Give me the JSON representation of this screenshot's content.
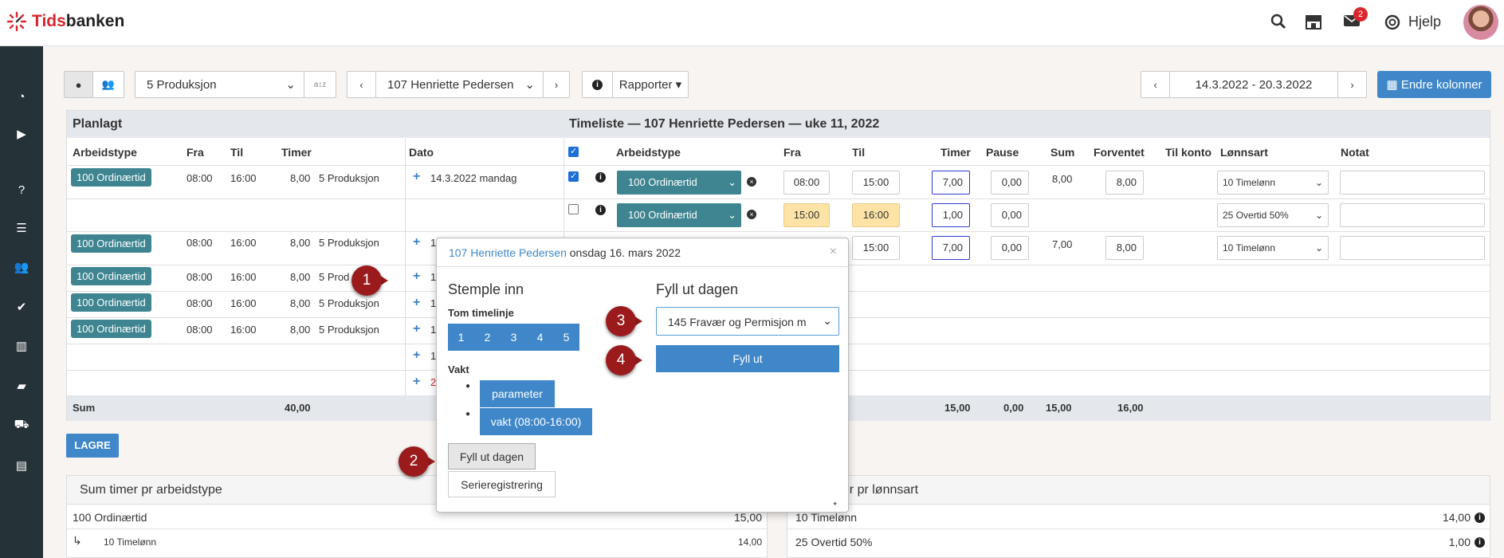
{
  "topbar": {
    "logo_part1": "Tids",
    "logo_part2": "banken",
    "mail_badge": "2",
    "help_label": "Hjelp"
  },
  "toolbar": {
    "department": "5 Produksjon",
    "employee": "107 Henriette Pedersen",
    "reports": "Rapporter",
    "date_range": "14.3.2022 - 20.3.2022",
    "change_columns": "Endre kolonner"
  },
  "planned": {
    "title": "Planlagt",
    "headers": {
      "type": "Arbeidstype",
      "from": "Fra",
      "to": "Til",
      "hours": "Timer",
      "date": "Dato"
    },
    "rows": [
      {
        "type": "100 Ordinærtid",
        "from": "08:00",
        "to": "16:00",
        "hours": "8,00",
        "dept": "5 Produksjon",
        "date": "14.3.2022 mandag"
      },
      {
        "type": "",
        "from": "",
        "to": "",
        "hours": "",
        "dept": "",
        "date": ""
      },
      {
        "type": "100 Ordinærtid",
        "from": "08:00",
        "to": "16:00",
        "hours": "8,00",
        "dept": "5 Produksjon",
        "date": "1"
      },
      {
        "type": "100 Ordinærtid",
        "from": "08:00",
        "to": "16:00",
        "hours": "8,00",
        "dept": "5 Prod",
        "date": "1"
      },
      {
        "type": "100 Ordinærtid",
        "from": "08:00",
        "to": "16:00",
        "hours": "8,00",
        "dept": "5 Produksjon",
        "date": "1"
      },
      {
        "type": "100 Ordinærtid",
        "from": "08:00",
        "to": "16:00",
        "hours": "8,00",
        "dept": "5 Produksjon",
        "date": "1"
      },
      {
        "type": "",
        "from": "",
        "to": "",
        "hours": "",
        "dept": "",
        "date": "1"
      },
      {
        "type": "",
        "from": "",
        "to": "",
        "hours": "",
        "dept": "",
        "date": "2"
      }
    ],
    "sum_label": "Sum",
    "sum_hours": "40,00"
  },
  "timesheet": {
    "title": "Timeliste — 107 Henriette Pedersen — uke 11, 2022",
    "headers": {
      "type": "Arbeidstype",
      "from": "Fra",
      "to": "Til",
      "hours": "Timer",
      "pause": "Pause",
      "sum": "Sum",
      "expected": "Forventet",
      "to_account": "Til konto",
      "wage": "Lønnsart",
      "note": "Notat"
    },
    "rows": [
      {
        "checked": true,
        "type": "100 Ordinærtid",
        "from": "08:00",
        "to": "15:00",
        "hours": "7,00",
        "pause": "0,00",
        "sum": "8,00",
        "expected": "8,00",
        "wage": "10 Timelønn",
        "note": ""
      },
      {
        "checked": false,
        "type": "100 Ordinærtid",
        "from": "15:00",
        "to": "16:00",
        "hours": "1,00",
        "pause": "0,00",
        "sum": "",
        "expected": "",
        "wage": "25 Overtid 50%",
        "note": ""
      },
      {
        "checked": true,
        "type": "",
        "from": "",
        "to": "15:00",
        "hours": "7,00",
        "pause": "0,00",
        "sum": "7,00",
        "expected": "8,00",
        "wage": "10 Timelønn",
        "note": ""
      }
    ],
    "sum_hours": "15,00",
    "sum_pause": "0,00",
    "sum_sum": "15,00",
    "sum_expected": "16,00"
  },
  "save_label": "LAGRE",
  "sum_by_type": {
    "title": "Sum timer pr arbeidstype",
    "rows": [
      {
        "label": "100 Ordinærtid",
        "value": "15,00"
      },
      {
        "label": "10 Timelønn",
        "value": "14,00"
      }
    ]
  },
  "sum_by_wage": {
    "title": "ner pr lønnsart",
    "rows": [
      {
        "label": "10 Timelønn",
        "value": "14,00"
      },
      {
        "label": "25 Overtid 50%",
        "value": "1,00"
      }
    ]
  },
  "popup": {
    "employee": "107 Henriette Pedersen",
    "date": "onsdag 16. mars 2022",
    "close": "×",
    "stamp_title": "Stemple inn",
    "empty_timeline": "Tom timelinje",
    "slots": [
      "1",
      "2",
      "3",
      "4",
      "5"
    ],
    "shift_label": "Vakt",
    "shift_items": [
      "parameter",
      "vakt (08:00-16:00)"
    ],
    "fill_day_button": "Fyll ut dagen",
    "series_button": "Serieregistrering",
    "fill_title": "Fyll ut dagen",
    "fill_select": "145 Fravær og Permisjon m",
    "fill_button": "Fyll ut",
    "footnote": "*"
  },
  "markers": [
    "1",
    "2",
    "3",
    "4"
  ],
  "colors": {
    "accent": "#3f87c8",
    "teal": "#3e8591",
    "sidebar": "#253238",
    "marker": "#9b1b1d",
    "highlight": "#fde3a6"
  }
}
